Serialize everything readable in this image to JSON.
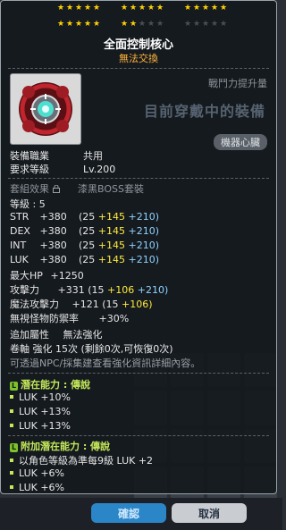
{
  "item": {
    "name": "全面控制核心",
    "tradeable": "無法交換",
    "cp_label": "戰鬥力提升量",
    "equipped_text": "目前穿戴中的裝備",
    "category": "機器心臟"
  },
  "stars": {
    "filled": 17,
    "total": 25
  },
  "req": {
    "job_label": "裝備職業",
    "job_value": "共用",
    "level_label": "要求等級",
    "level_value": "Lv.200"
  },
  "set": {
    "label": "套組效果",
    "value": "漆黑BOSS套裝"
  },
  "grade": "等級 : 5",
  "stats": [
    {
      "name": "STR",
      "total": "+380",
      "base": "(25",
      "bonus": "+145",
      "enh": "+210)"
    },
    {
      "name": "DEX",
      "total": "+380",
      "base": "(25",
      "bonus": "+145",
      "enh": "+210)"
    },
    {
      "name": "INT",
      "total": "+380",
      "base": "(25",
      "bonus": "+145",
      "enh": "+210)"
    },
    {
      "name": "LUK",
      "total": "+380",
      "base": "(25",
      "bonus": "+145",
      "enh": "+210)"
    }
  ],
  "hp": {
    "label": "最大HP",
    "value": "+1250"
  },
  "atk": {
    "label": "攻擊力",
    "total": "+331",
    "base": "(15",
    "bonus": "+106",
    "enh": "+210)"
  },
  "matk": {
    "label": "魔法攻擊力",
    "total": "+121",
    "base": "(15",
    "bonus": "+106)"
  },
  "ied": {
    "label": "無視怪物防禦率",
    "value": "+30%"
  },
  "extra": {
    "label": "追加屬性",
    "value": "無法強化"
  },
  "scroll": {
    "text": "卷軸 強化 15次 (剩餘0次,可恢復0次)"
  },
  "note": "可透過NPC/採集建查看強化資訊詳細內容。",
  "potential": {
    "badge": "L",
    "title": "潛在能力 : 傳說",
    "lines": [
      "LUK +10%",
      "LUK +13%",
      "LUK +13%"
    ]
  },
  "bonus_potential": {
    "badge": "L",
    "title": "附加潛在能力 : 傳說",
    "lines": [
      "以角色等級為準每9級 LUK +2",
      "LUK +6%",
      "LUK +6%"
    ]
  },
  "buttons": {
    "ok": "確認",
    "cancel": "取消"
  },
  "colors": {
    "star": "#ffd200",
    "legend": "#c4e85a",
    "bonus": "#ffea3d",
    "enh": "#8fd3ff"
  }
}
